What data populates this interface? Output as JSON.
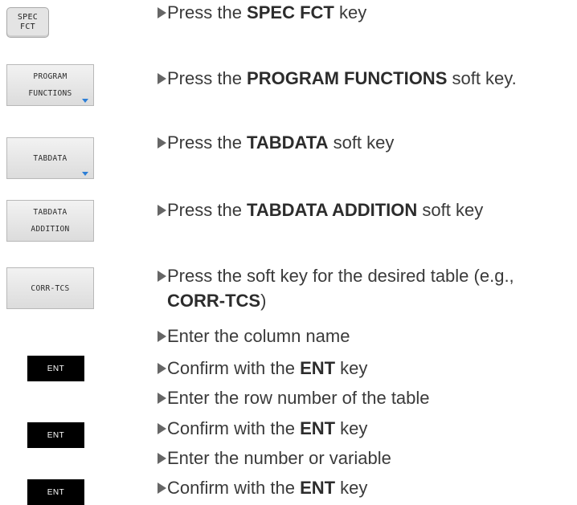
{
  "keys": {
    "spec_fct": {
      "line1": "SPEC",
      "line2": "FCT"
    },
    "program_functions": {
      "line1": "PROGRAM",
      "line2": "FUNCTIONS"
    },
    "tabdata": {
      "label": "TABDATA"
    },
    "tabdata_addition": {
      "line1": "TABDATA",
      "line2": "ADDITION"
    },
    "corr_tcs": {
      "label": "CORR-TCS"
    },
    "ent": "ENT"
  },
  "steps": [
    {
      "pre": "Press the ",
      "bold": "SPEC FCT",
      "post": " key"
    },
    {
      "pre": "Press the ",
      "bold": "PROGRAM FUNCTIONS",
      "post": " soft key."
    },
    {
      "pre": "Press the ",
      "bold": "TABDATA",
      "post": " soft key"
    },
    {
      "pre": "Press the ",
      "bold": "TABDATA ADDITION",
      "post": " soft key"
    },
    {
      "pre": "Press the soft key for the desired table (e.g., ",
      "bold": "CORR-TCS",
      "post": ")"
    },
    {
      "text": "Enter the column name"
    },
    {
      "pre": "Confirm with the ",
      "bold": "ENT",
      "post": " key"
    },
    {
      "text": "Enter the row number of the table"
    },
    {
      "pre": "Confirm with the ",
      "bold": "ENT",
      "post": " key"
    },
    {
      "text": "Enter the number or variable"
    },
    {
      "pre": "Confirm with the ",
      "bold": "ENT",
      "post": " key"
    }
  ]
}
